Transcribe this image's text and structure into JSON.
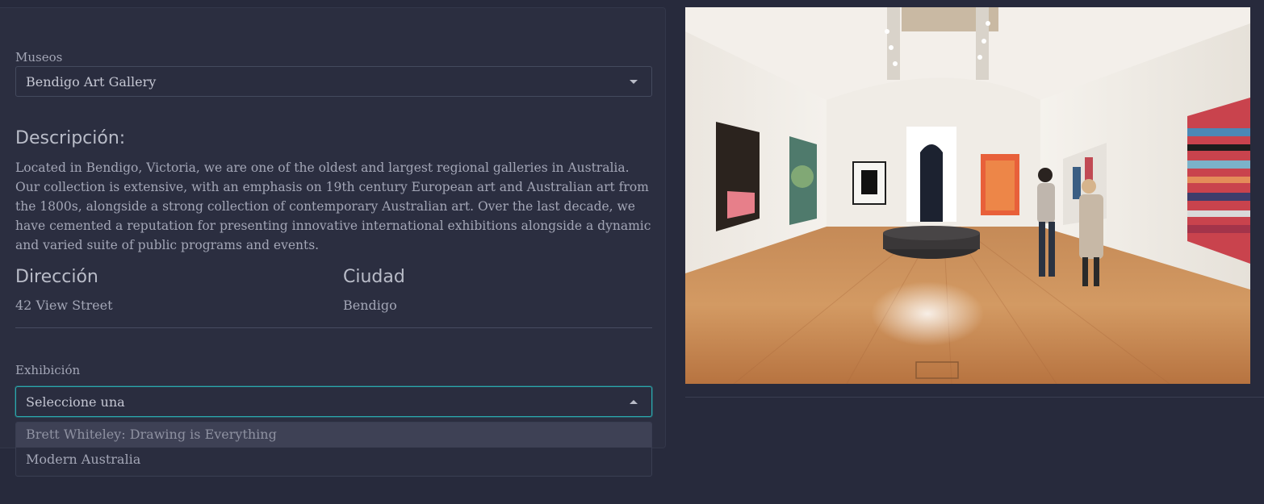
{
  "museum_select": {
    "label": "Museos",
    "value": "Bendigo Art Gallery"
  },
  "description": {
    "heading": "Descripción:",
    "text": "Located in Bendigo, Victoria, we are one of the oldest and largest regional galleries in Australia. Our collection is extensive, with an emphasis on 19th century European art and Australian art from the 1800s, alongside a strong collection of contemporary Australian art. Over the last decade, we have cemented a reputation for presenting innovative international exhibitions alongside a dynamic and varied suite of public programs and events."
  },
  "address": {
    "heading": "Dirección",
    "value": "42 View Street"
  },
  "city": {
    "heading": "Ciudad",
    "value": "Bendigo"
  },
  "exhibition_select": {
    "label": "Exhibición",
    "value": "Seleccione una",
    "options": [
      "Brett Whiteley: Drawing is Everything",
      "Modern Australia"
    ]
  },
  "colors": {
    "background": "#272a3c",
    "card": "#2b2e40",
    "focus_border": "#2aa8ad"
  }
}
